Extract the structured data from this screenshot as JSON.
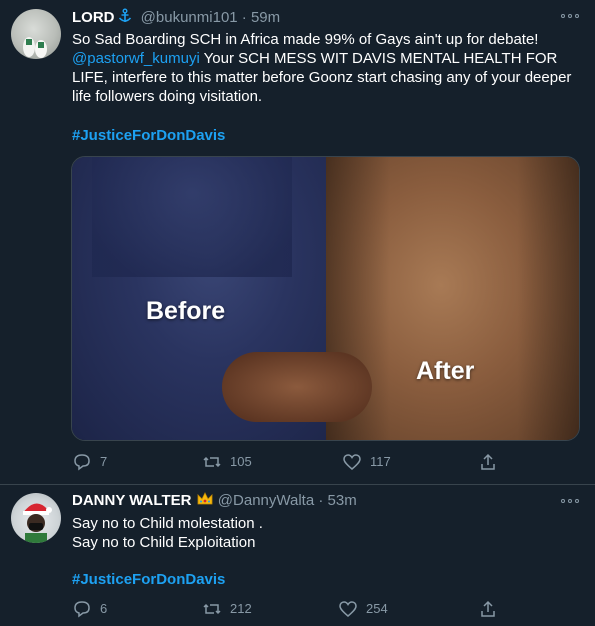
{
  "tweets": [
    {
      "name": "LORD",
      "badge": "anchor-icon",
      "handle": "@bukunmi101",
      "separator": "·",
      "time": "59m",
      "text_intro": "So Sad Boarding SCH in Africa made 99% of Gays ain't up for debate!",
      "mention": "@pastorwf_kumuyi",
      "text_rest": " Your SCH MESS WIT DAVIS MENTAL HEALTH FOR LIFE, interfere to this matter before Goonz start  chasing any of your deeper life followers doing visitation.",
      "hashtag": "#JusticeForDonDavis",
      "media": {
        "left_label": "Before",
        "right_label": "After"
      },
      "replies": "7",
      "retweets": "105",
      "likes": "117"
    },
    {
      "name": "DANNY WALTER",
      "badge": "crown-emoji",
      "handle": "@DannyWalta",
      "separator": "·",
      "time": "53m",
      "line1": "Say no to Child molestation .",
      "line2": "Say no to Child Exploitation",
      "hashtag": "#JusticeForDonDavis",
      "replies": "6",
      "retweets": "212",
      "likes": "254"
    }
  ],
  "colors": {
    "background": "#15202b",
    "link": "#1da1f2",
    "muted": "#8899a6",
    "divider": "#38444d"
  }
}
